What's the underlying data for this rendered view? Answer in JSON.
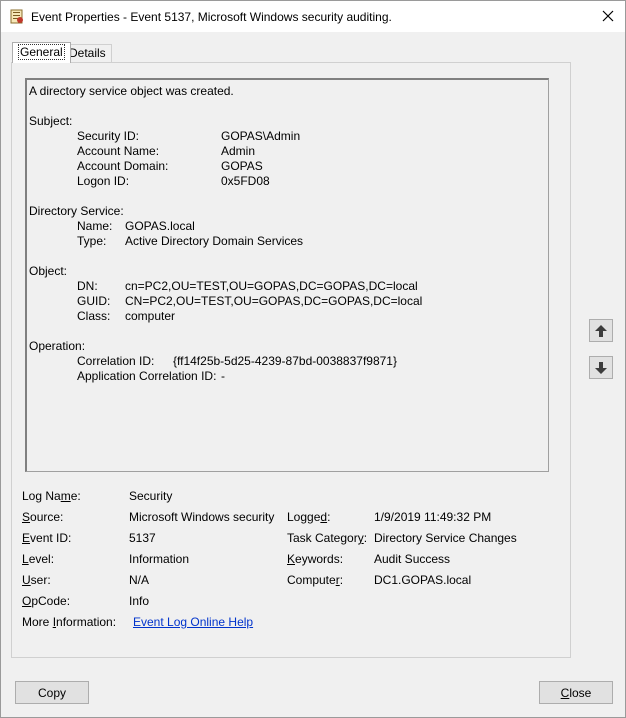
{
  "window": {
    "title": "Event Properties - Event 5137, Microsoft Windows security auditing."
  },
  "tabs": {
    "general": "General",
    "details": "Details"
  },
  "description": {
    "summary": "A directory service object was created.",
    "subject": {
      "heading": "Subject:",
      "security_id_label": "Security ID:",
      "security_id": "GOPAS\\Admin",
      "account_name_label": "Account Name:",
      "account_name": "Admin",
      "account_domain_label": "Account Domain:",
      "account_domain": "GOPAS",
      "logon_id_label": "Logon ID:",
      "logon_id": "0x5FD08"
    },
    "directory_service": {
      "heading": "Directory Service:",
      "name_label": "Name:",
      "name": "GOPAS.local",
      "type_label": "Type:",
      "type": "Active Directory Domain Services"
    },
    "object": {
      "heading": "Object:",
      "dn_label": "DN:",
      "dn": "cn=PC2,OU=TEST,OU=GOPAS,DC=GOPAS,DC=local",
      "guid_label": "GUID:",
      "guid": "CN=PC2,OU=TEST,OU=GOPAS,DC=GOPAS,DC=local",
      "class_label": "Class:",
      "class": "computer"
    },
    "operation": {
      "heading": "Operation:",
      "correlation_id_label": "Correlation ID:",
      "correlation_id": "{ff14f25b-5d25-4239-87bd-0038837f9871}",
      "app_correlation_id_label": "Application Correlation ID:",
      "app_correlation_id": "-"
    }
  },
  "fields": {
    "log_name": {
      "label_pre": "Log Na",
      "label_key": "m",
      "label_post": "e:",
      "value": "Security"
    },
    "source": {
      "label_pre": "",
      "label_key": "S",
      "label_post": "ource:",
      "value": "Microsoft Windows security"
    },
    "logged": {
      "label_pre": "Logge",
      "label_key": "d",
      "label_post": ":",
      "value": "1/9/2019 11:49:32 PM"
    },
    "event_id": {
      "label_pre": "",
      "label_key": "E",
      "label_post": "vent ID:",
      "value": "5137"
    },
    "task_category": {
      "label_pre": "Task Categor",
      "label_key": "y",
      "label_post": ":",
      "value": "Directory Service Changes"
    },
    "level": {
      "label_pre": "",
      "label_key": "L",
      "label_post": "evel:",
      "value": "Information"
    },
    "keywords": {
      "label_pre": "",
      "label_key": "K",
      "label_post": "eywords:",
      "value": "Audit Success"
    },
    "user": {
      "label_pre": "",
      "label_key": "U",
      "label_post": "ser:",
      "value": "N/A"
    },
    "computer": {
      "label_pre": "Compute",
      "label_key": "r",
      "label_post": ":",
      "value": "DC1.GOPAS.local"
    },
    "opcode": {
      "label_pre": "",
      "label_key": "O",
      "label_post": "pCode:",
      "value": "Info"
    },
    "more_info": {
      "label_pre": "More ",
      "label_key": "I",
      "label_post": "nformation:",
      "link": "Event Log Online Help"
    }
  },
  "buttons": {
    "copy": "Copy",
    "close_pre": "",
    "close_key": "C",
    "close_post": "lose"
  },
  "icons": {
    "up": "arrow-up-icon",
    "down": "arrow-down-icon",
    "close": "close-icon",
    "app": "event-log-icon"
  }
}
